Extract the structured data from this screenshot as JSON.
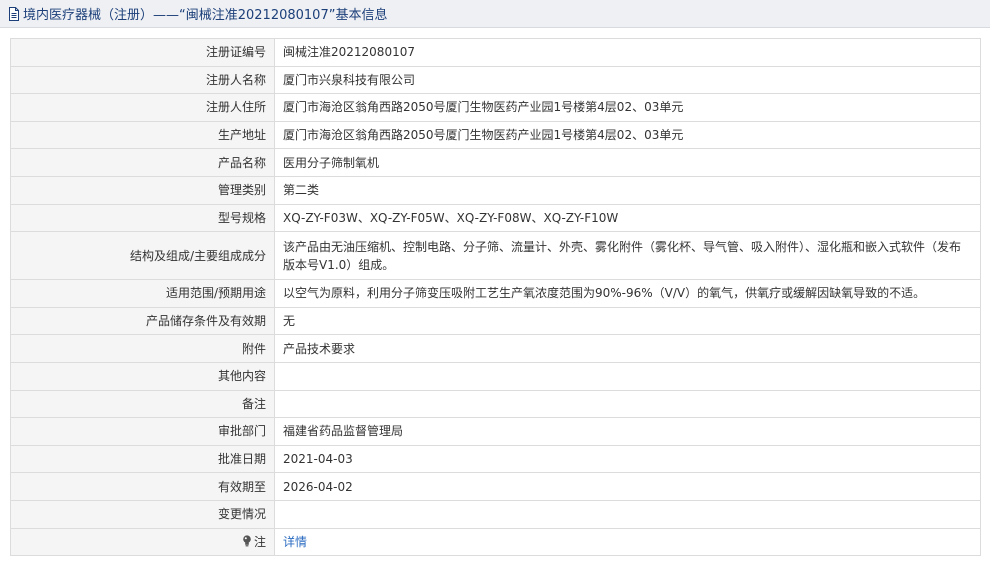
{
  "header": {
    "title": "境内医疗器械（注册）——“闽械注准20212080107”基本信息",
    "icon": "document-icon"
  },
  "rows": [
    {
      "label": "注册证编号",
      "value": "闽械注准20212080107"
    },
    {
      "label": "注册人名称",
      "value": "厦门市兴泉科技有限公司"
    },
    {
      "label": "注册人住所",
      "value": "厦门市海沧区翁角西路2050号厦门生物医药产业园1号楼第4层02、03单元"
    },
    {
      "label": "生产地址",
      "value": "厦门市海沧区翁角西路2050号厦门生物医药产业园1号楼第4层02、03单元"
    },
    {
      "label": "产品名称",
      "value": "医用分子筛制氧机"
    },
    {
      "label": "管理类别",
      "value": "第二类"
    },
    {
      "label": "型号规格",
      "value": "XQ-ZY-F03W、XQ-ZY-F05W、XQ-ZY-F08W、XQ-ZY-F10W"
    },
    {
      "label": "结构及组成/主要组成成分",
      "value": "该产品由无油压缩机、控制电路、分子筛、流量计、外壳、雾化附件（雾化杯、导气管、吸入附件）、湿化瓶和嵌入式软件（发布版本号V1.0）组成。"
    },
    {
      "label": "适用范围/预期用途",
      "value": "以空气为原料，利用分子筛变压吸附工艺生产氧浓度范围为90%-96%（V/V）的氧气，供氧疗或缓解因缺氧导致的不适。"
    },
    {
      "label": "产品储存条件及有效期",
      "value": "无"
    },
    {
      "label": "附件",
      "value": "产品技术要求"
    },
    {
      "label": "其他内容",
      "value": ""
    },
    {
      "label": "备注",
      "value": ""
    },
    {
      "label": "审批部门",
      "value": "福建省药品监督管理局"
    },
    {
      "label": "批准日期",
      "value": "2021-04-03"
    },
    {
      "label": "有效期至",
      "value": "2026-04-02"
    },
    {
      "label": "变更情况",
      "value": ""
    },
    {
      "label": "注",
      "value": "详情",
      "icon": "bulb-icon"
    }
  ],
  "colors": {
    "title": "#1c3f7a",
    "label_bg": "#f5f5f5",
    "border": "#dcdcdc",
    "link": "#2a6bc1"
  }
}
